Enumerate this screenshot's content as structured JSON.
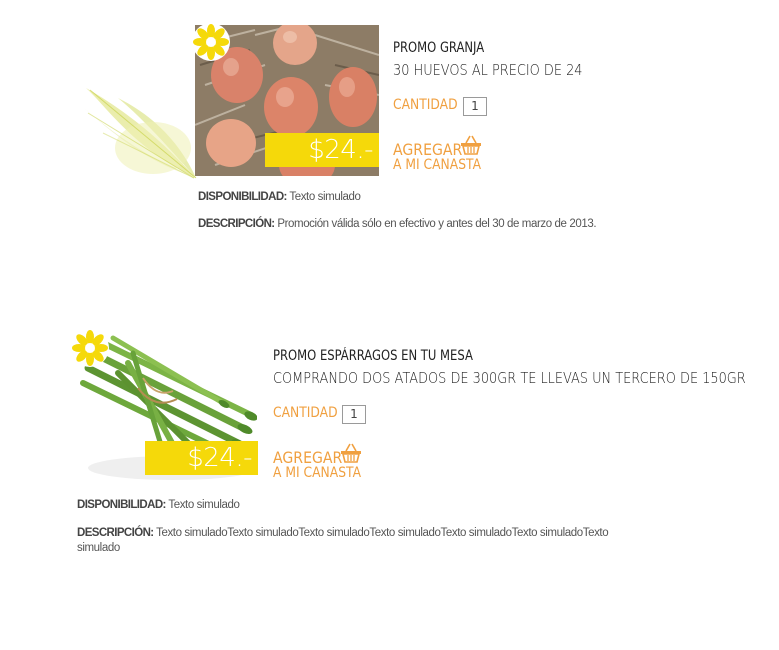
{
  "products": [
    {
      "title": "PROMO GRANJA",
      "subtitle": "30 HUEVOS AL PRECIO DE 24",
      "price": "$24.-",
      "quantity_label": "CANTIDAD",
      "quantity_value": "1",
      "add_line1": "AGREGAR",
      "add_line2": "A MI CANASTA",
      "availability_label": "DISPONIBILIDAD:",
      "availability_value": "Texto simulado",
      "description_label": "DESCRIPCIÓN:",
      "description_value": "Promoción válida sólo en efectivo y antes del 30 de marzo de 2013."
    },
    {
      "title": "PROMO ESPÁRRAGOS EN TU MESA",
      "subtitle": "COMPRANDO DOS ATADOS DE 300GR TE LLEVAS UN TERCERO DE 150GR",
      "price": "$24.-",
      "quantity_label": "CANTIDAD",
      "quantity_value": "1",
      "add_line1": "AGREGAR",
      "add_line2": "A MI CANASTA",
      "availability_label": "DISPONIBILIDAD:",
      "availability_value": "Texto simulado",
      "description_label": "DESCRIPCIÓN:",
      "description_value": "Texto simuladoTexto simuladoTexto simuladoTexto simuladoTexto simuladoTexto simuladoTexto simulado"
    }
  ],
  "colors": {
    "accent_orange": "#f0a040",
    "price_yellow": "#f5d90a",
    "flower_yellow": "#f5d90a"
  },
  "icons": [
    "flower-badge-icon",
    "basket-icon",
    "leaf-decoration-icon"
  ]
}
